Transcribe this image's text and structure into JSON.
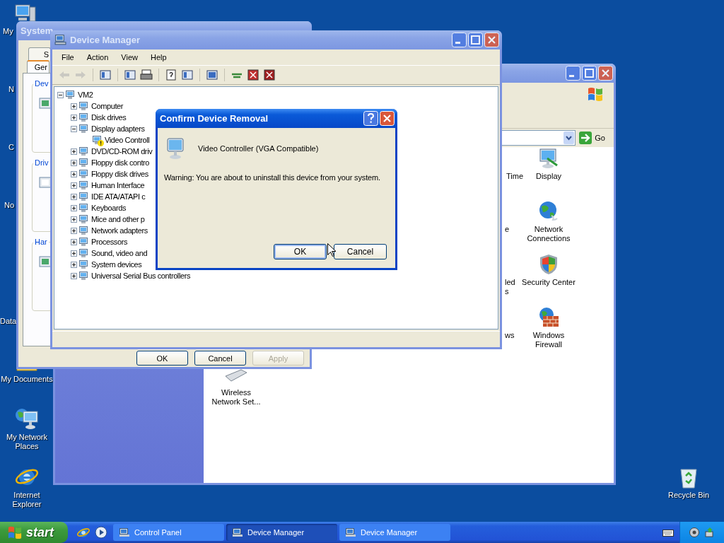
{
  "desktop_icons": [
    {
      "label": "My"
    },
    {
      "label": "N"
    },
    {
      "label": "C"
    },
    {
      "label": "No"
    },
    {
      "label": "Data"
    },
    {
      "label": "My Documents"
    },
    {
      "label": "My Network Places"
    },
    {
      "label": "Internet Explorer"
    },
    {
      "label": "Recycle Bin"
    }
  ],
  "control_panel": {
    "active": false,
    "go_label": "Go",
    "items": [
      {
        "label": "Time"
      },
      {
        "label": "Display"
      },
      {
        "label": "e"
      },
      {
        "label": "Network Connections"
      },
      {
        "label": "led\ns"
      },
      {
        "label": "Security Center"
      },
      {
        "label": "ws"
      },
      {
        "label": "Windows Firewall"
      },
      {
        "label": "Wireless Network Set..."
      }
    ]
  },
  "system_properties": {
    "active": false,
    "title": "System",
    "tabs": [
      {
        "label": "S",
        "selected": false
      },
      {
        "label": "Ger",
        "selected": true
      }
    ],
    "groups": [
      "Dev",
      "Driv",
      "Har"
    ],
    "buttons": [
      {
        "label": "OK",
        "disabled": false
      },
      {
        "label": "Cancel",
        "disabled": false
      },
      {
        "label": "Apply",
        "disabled": true
      }
    ]
  },
  "device_manager": {
    "active": false,
    "title": "Device Manager",
    "menu": [
      "File",
      "Action",
      "View",
      "Help"
    ],
    "toolbar": [
      {
        "disabled": true
      },
      {
        "disabled": true
      },
      {
        "disabled": false
      },
      {
        "disabled": false
      },
      {
        "disabled": false
      },
      {
        "disabled": false
      },
      {
        "disabled": false
      },
      {
        "disabled": false
      },
      {
        "disabled": false
      },
      {
        "disabled": false
      },
      {
        "disabled": false
      }
    ],
    "tree": {
      "label": "VM2",
      "expanded": true,
      "children": [
        {
          "label": "Computer",
          "expanded": false
        },
        {
          "label": "Disk drives",
          "expanded": false
        },
        {
          "label": "Display adapters",
          "expanded": true,
          "children": [
            {
              "label": "Video Controll",
              "warning": true
            }
          ]
        },
        {
          "label": "DVD/CD-ROM driv",
          "expanded": false
        },
        {
          "label": "Floppy disk contro",
          "expanded": false
        },
        {
          "label": "Floppy disk drives",
          "expanded": false
        },
        {
          "label": "Human Interface",
          "expanded": false
        },
        {
          "label": "IDE ATA/ATAPI c",
          "expanded": false
        },
        {
          "label": "Keyboards",
          "expanded": false
        },
        {
          "label": "Mice and other p",
          "expanded": false
        },
        {
          "label": "Network adapters",
          "expanded": false
        },
        {
          "label": "Processors",
          "expanded": false
        },
        {
          "label": "Sound, video and",
          "expanded": false
        },
        {
          "label": "System devices",
          "expanded": false
        },
        {
          "label": "Universal Serial Bus controllers",
          "expanded": false
        }
      ]
    }
  },
  "dialog": {
    "active": true,
    "title": "Confirm Device Removal",
    "device": "Video Controller (VGA Compatible)",
    "warning": "Warning: You are about to uninstall this device from your system.",
    "buttons": [
      {
        "label": "OK",
        "default": true
      },
      {
        "label": "Cancel",
        "default": false
      }
    ]
  },
  "taskbar": {
    "start": "start",
    "tasks": [
      {
        "label": "Control Panel",
        "selected": false
      },
      {
        "label": "Device Manager",
        "selected": true
      },
      {
        "label": "Device Manager",
        "selected": false
      }
    ]
  }
}
